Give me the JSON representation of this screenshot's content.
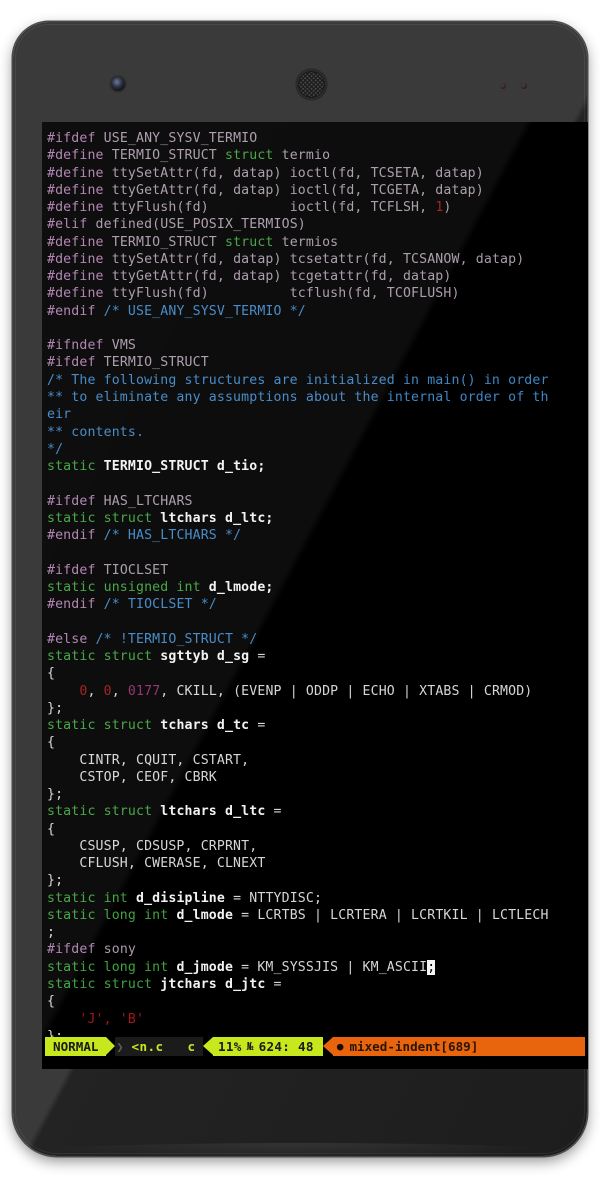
{
  "device": {
    "name": "android-phone",
    "hardware": {
      "front_camera": "front-camera",
      "earpiece": "earpiece-speaker",
      "sensors": [
        "proximity-sensor-dot",
        "light-sensor-dot"
      ]
    }
  },
  "editor": {
    "app": "vim",
    "lines": [
      [
        {
          "t": "#ifdef",
          "c": "pre"
        },
        {
          "t": " USE_ANY_SYSV_TERMIO",
          "c": "prearg"
        }
      ],
      [
        {
          "t": "#define",
          "c": "pre"
        },
        {
          "t": " TERMIO_STRUCT ",
          "c": "prearg"
        },
        {
          "t": "struct",
          "c": "kw"
        },
        {
          "t": " termio",
          "c": "prearg"
        }
      ],
      [
        {
          "t": "#define",
          "c": "pre"
        },
        {
          "t": " ttySetAttr(fd, datap) ioctl(fd, TCSETA, datap)",
          "c": "prearg"
        }
      ],
      [
        {
          "t": "#define",
          "c": "pre"
        },
        {
          "t": " ttyGetAttr(fd, datap) ioctl(fd, TCGETA, datap)",
          "c": "prearg"
        }
      ],
      [
        {
          "t": "#define",
          "c": "pre"
        },
        {
          "t": " ttyFlush(fd)          ioctl(fd, TCFLSH, ",
          "c": "prearg"
        },
        {
          "t": "1",
          "c": "num"
        },
        {
          "t": ")",
          "c": "prearg"
        }
      ],
      [
        {
          "t": "#elif",
          "c": "pre"
        },
        {
          "t": " defined(USE_POSIX_TERMIOS)",
          "c": "prearg"
        }
      ],
      [
        {
          "t": "#define",
          "c": "pre"
        },
        {
          "t": " TERMIO_STRUCT ",
          "c": "prearg"
        },
        {
          "t": "struct",
          "c": "kw"
        },
        {
          "t": " termios",
          "c": "prearg"
        }
      ],
      [
        {
          "t": "#define",
          "c": "pre"
        },
        {
          "t": " ttySetAttr(fd, datap) tcsetattr(fd, TCSANOW, datap)",
          "c": "prearg"
        }
      ],
      [
        {
          "t": "#define",
          "c": "pre"
        },
        {
          "t": " ttyGetAttr(fd, datap) tcgetattr(fd, datap)",
          "c": "prearg"
        }
      ],
      [
        {
          "t": "#define",
          "c": "pre"
        },
        {
          "t": " ttyFlush(fd)          tcflush(fd, TCOFLUSH)",
          "c": "prearg"
        }
      ],
      [
        {
          "t": "#endif",
          "c": "pre"
        },
        {
          "t": " ",
          "c": "txt"
        },
        {
          "t": "/* USE_ANY_SYSV_TERMIO */",
          "c": "cmt"
        }
      ],
      [
        {
          "t": "",
          "c": "txt"
        }
      ],
      [
        {
          "t": "#ifndef",
          "c": "pre"
        },
        {
          "t": " VMS",
          "c": "prearg"
        }
      ],
      [
        {
          "t": "#ifdef",
          "c": "pre"
        },
        {
          "t": " TERMIO_STRUCT",
          "c": "prearg"
        }
      ],
      [
        {
          "t": "/* The following structures are initialized in main() in order",
          "c": "cmt"
        }
      ],
      [
        {
          "t": "** to eliminate any assumptions about the internal order of th",
          "c": "cmt"
        }
      ],
      [
        {
          "t": "eir",
          "c": "cmt"
        }
      ],
      [
        {
          "t": "** contents.",
          "c": "cmt"
        }
      ],
      [
        {
          "t": "*/",
          "c": "cmt"
        }
      ],
      [
        {
          "t": "static",
          "c": "kw"
        },
        {
          "t": " ",
          "c": "txt"
        },
        {
          "t": "TERMIO_STRUCT d_tio;",
          "c": "id"
        }
      ],
      [
        {
          "t": "",
          "c": "txt"
        }
      ],
      [
        {
          "t": "#ifdef",
          "c": "pre"
        },
        {
          "t": " HAS_LTCHARS",
          "c": "prearg"
        }
      ],
      [
        {
          "t": "static struct",
          "c": "kw"
        },
        {
          "t": " ",
          "c": "txt"
        },
        {
          "t": "ltchars d_ltc;",
          "c": "id"
        }
      ],
      [
        {
          "t": "#endif",
          "c": "pre"
        },
        {
          "t": " ",
          "c": "txt"
        },
        {
          "t": "/* HAS_LTCHARS */",
          "c": "cmt"
        }
      ],
      [
        {
          "t": "",
          "c": "txt"
        }
      ],
      [
        {
          "t": "#ifdef",
          "c": "pre"
        },
        {
          "t": " TIOCLSET",
          "c": "prearg"
        }
      ],
      [
        {
          "t": "static unsigned int",
          "c": "kw"
        },
        {
          "t": " ",
          "c": "txt"
        },
        {
          "t": "d_lmode;",
          "c": "id"
        }
      ],
      [
        {
          "t": "#endif",
          "c": "pre"
        },
        {
          "t": " ",
          "c": "txt"
        },
        {
          "t": "/* TIOCLSET */",
          "c": "cmt"
        }
      ],
      [
        {
          "t": "",
          "c": "txt"
        }
      ],
      [
        {
          "t": "#else",
          "c": "pre"
        },
        {
          "t": " ",
          "c": "txt"
        },
        {
          "t": "/* !TERMIO_STRUCT */",
          "c": "cmt"
        }
      ],
      [
        {
          "t": "static struct",
          "c": "kw"
        },
        {
          "t": " ",
          "c": "txt"
        },
        {
          "t": "sgttyb d_sg",
          "c": "id"
        },
        {
          "t": " =",
          "c": "txt"
        }
      ],
      [
        {
          "t": "{",
          "c": "txt"
        }
      ],
      [
        {
          "t": "    ",
          "c": "txt"
        },
        {
          "t": "0",
          "c": "num"
        },
        {
          "t": ", ",
          "c": "txt"
        },
        {
          "t": "0",
          "c": "num"
        },
        {
          "t": ", ",
          "c": "txt"
        },
        {
          "t": "0177",
          "c": "oct"
        },
        {
          "t": ", CKILL, (EVENP | ODDP | ECHO | XTABS | CRMOD)",
          "c": "txt"
        }
      ],
      [
        {
          "t": "};",
          "c": "txt"
        }
      ],
      [
        {
          "t": "static struct",
          "c": "kw"
        },
        {
          "t": " ",
          "c": "txt"
        },
        {
          "t": "tchars d_tc",
          "c": "id"
        },
        {
          "t": " =",
          "c": "txt"
        }
      ],
      [
        {
          "t": "{",
          "c": "txt"
        }
      ],
      [
        {
          "t": "    CINTR, CQUIT, CSTART,",
          "c": "txt"
        }
      ],
      [
        {
          "t": "    CSTOP, CEOF, CBRK",
          "c": "txt"
        }
      ],
      [
        {
          "t": "};",
          "c": "txt"
        }
      ],
      [
        {
          "t": "static struct",
          "c": "kw"
        },
        {
          "t": " ",
          "c": "txt"
        },
        {
          "t": "ltchars d_ltc",
          "c": "id"
        },
        {
          "t": " =",
          "c": "txt"
        }
      ],
      [
        {
          "t": "{",
          "c": "txt"
        }
      ],
      [
        {
          "t": "    CSUSP, CDSUSP, CRPRNT,",
          "c": "txt"
        }
      ],
      [
        {
          "t": "    CFLUSH, CWERASE, CLNEXT",
          "c": "txt"
        }
      ],
      [
        {
          "t": "};",
          "c": "txt"
        }
      ],
      [
        {
          "t": "static int",
          "c": "kw"
        },
        {
          "t": " ",
          "c": "txt"
        },
        {
          "t": "d_disipline",
          "c": "id"
        },
        {
          "t": " = NTTYDISC;",
          "c": "txt"
        }
      ],
      [
        {
          "t": "static long int",
          "c": "kw"
        },
        {
          "t": " ",
          "c": "txt"
        },
        {
          "t": "d_lmode",
          "c": "id"
        },
        {
          "t": " = LCRTBS | LCRTERA | LCRTKIL | LCTLECH",
          "c": "txt"
        }
      ],
      [
        {
          "t": ";",
          "c": "txt"
        }
      ],
      [
        {
          "t": "#ifdef",
          "c": "pre"
        },
        {
          "t": " sony",
          "c": "prearg"
        }
      ],
      [
        {
          "t": "static long int",
          "c": "kw"
        },
        {
          "t": " ",
          "c": "txt"
        },
        {
          "t": "d_jmode",
          "c": "id"
        },
        {
          "t": " = KM_SYSSJIS | KM_ASCII",
          "c": "txt"
        },
        {
          "t": ";",
          "c": "cursor"
        }
      ],
      [
        {
          "t": "static struct",
          "c": "kw"
        },
        {
          "t": " ",
          "c": "txt"
        },
        {
          "t": "jtchars d_jtc",
          "c": "id"
        },
        {
          "t": " =",
          "c": "txt"
        }
      ],
      [
        {
          "t": "{",
          "c": "txt"
        }
      ],
      [
        {
          "t": "    ",
          "c": "txt"
        },
        {
          "t": "'J', 'B'",
          "c": "str"
        }
      ],
      [
        {
          "t": "};",
          "c": "txt"
        }
      ]
    ]
  },
  "status_line": {
    "mode": "NORMAL",
    "filename": "<n.c",
    "filetype": "c",
    "percent": "11%",
    "line_symbol": "№",
    "position": "624: 48",
    "warning_icon": "bug-icon",
    "warning": "mixed-indent[689]",
    "colors": {
      "mode_bg": "#c8e81e",
      "mode_fg": "#1a1a1a",
      "file_bg": "#1b1b1b",
      "file_fg": "#c8e81e",
      "pos_bg": "#c8e81e",
      "warn_bg": "#e8650d",
      "warn_fg": "#2a1505"
    }
  }
}
